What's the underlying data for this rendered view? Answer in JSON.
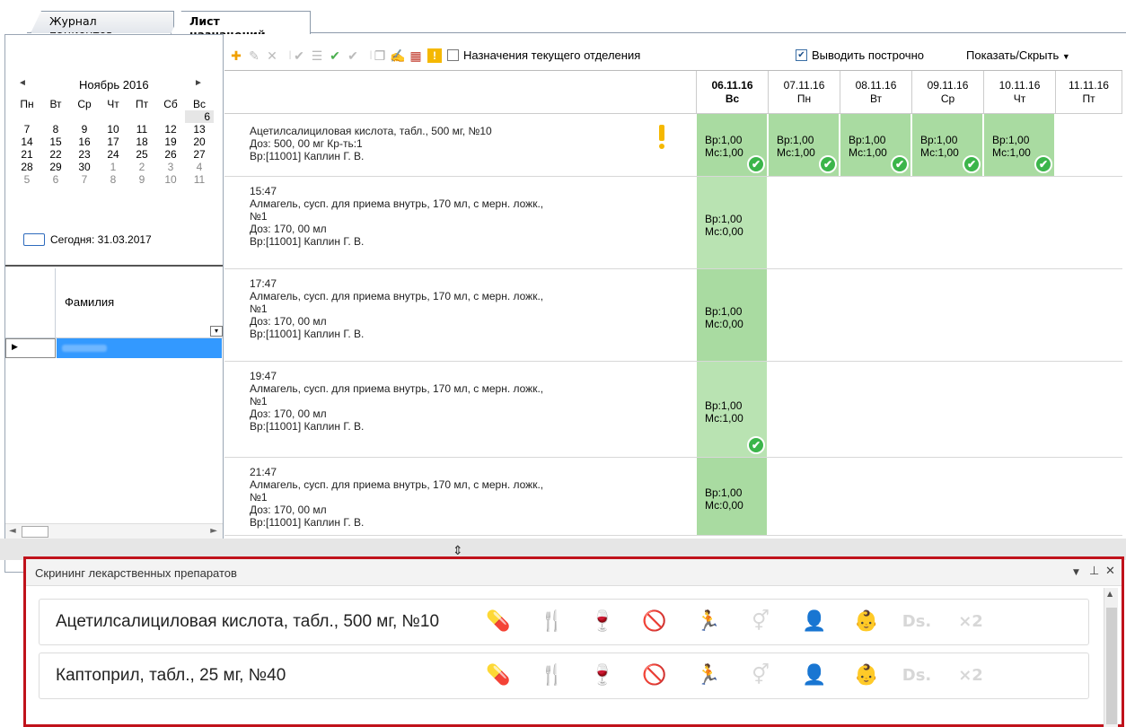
{
  "tabs": [
    {
      "label": "Журнал пациентов"
    },
    {
      "label": "Лист назначений"
    }
  ],
  "calendar": {
    "month": "Ноябрь 2016",
    "weekdays": [
      "Пн",
      "Вт",
      "Ср",
      "Чт",
      "Пт",
      "Сб",
      "Вс"
    ],
    "weeks": [
      [
        "",
        "",
        "",
        "",
        "",
        "",
        "6"
      ],
      [
        "7",
        "8",
        "9",
        "10",
        "11",
        "12",
        "13"
      ],
      [
        "14",
        "15",
        "16",
        "17",
        "18",
        "19",
        "20"
      ],
      [
        "21",
        "22",
        "23",
        "24",
        "25",
        "26",
        "27"
      ],
      [
        "28",
        "29",
        "30",
        "1",
        "2",
        "3",
        "4"
      ],
      [
        "5",
        "6",
        "7",
        "8",
        "9",
        "10",
        "11"
      ]
    ],
    "today": "Сегодня: 31.03.2017"
  },
  "patient_grid": {
    "column": "Фамилия",
    "pager_value": "1"
  },
  "toolbar": {
    "icons": [
      "add-icon",
      "edit-icon",
      "delete-icon",
      "check-icon",
      "list-icon",
      "all-check-icon",
      "double-check-icon",
      "copy-icon",
      "pen-icon",
      "calendar-icon",
      "warning-icon"
    ],
    "current_dept_label": "Назначения текущего отделения",
    "current_dept_checked": false,
    "row_output_label": "Выводить построчно",
    "row_output_checked": true,
    "show_hide_label": "Показать/Скрыть"
  },
  "dates": [
    {
      "date": "06.11.16",
      "day": "Вс"
    },
    {
      "date": "07.11.16",
      "day": "Пн"
    },
    {
      "date": "08.11.16",
      "day": "Вт"
    },
    {
      "date": "09.11.16",
      "day": "Ср"
    },
    {
      "date": "10.11.16",
      "day": "Чт"
    },
    {
      "date": "11.11.16",
      "day": "Пт"
    }
  ],
  "prescriptions": [
    {
      "lines": [
        "Ацетилсалициловая кислота, табл., 500 мг, №10",
        "Доз: 500, 00 мг Кр-ть:1",
        "Вр:[11001] Каплин Г. В."
      ],
      "warning": true,
      "cells": [
        {
          "vr": "Вр:1,00",
          "ms": "Мс:1,00",
          "done": true
        },
        {
          "vr": "Вр:1,00",
          "ms": "Мс:1,00",
          "done": true
        },
        {
          "vr": "Вр:1,00",
          "ms": "Мс:1,00",
          "done": true
        },
        {
          "vr": "Вр:1,00",
          "ms": "Мс:1,00",
          "done": true
        },
        {
          "vr": "Вр:1,00",
          "ms": "Мс:1,00",
          "done": true
        }
      ]
    },
    {
      "lines": [
        "15:47",
        "Алмагель, сусп. для приема внутрь, 170 мл, с мерн. ложк.,",
        "№1",
        "Доз: 170, 00 мл",
        "Вр:[11001] Каплин Г. В."
      ],
      "cells": [
        {
          "vr": "Вр:1,00",
          "ms": "Мс:0,00",
          "done": false
        }
      ]
    },
    {
      "lines": [
        "17:47",
        "Алмагель, сусп. для приема внутрь, 170 мл, с мерн. ложк.,",
        "№1",
        "Доз: 170, 00 мл",
        "Вр:[11001] Каплин Г. В."
      ],
      "cells": [
        {
          "vr": "Вр:1,00",
          "ms": "Мс:0,00",
          "done": false
        }
      ]
    },
    {
      "lines": [
        "19:47",
        "Алмагель, сусп. для приема внутрь, 170 мл, с мерн. ложк.,",
        "№1",
        "Доз: 170, 00 мл",
        "Вр:[11001] Каплин Г. В."
      ],
      "cells": [
        {
          "vr": "Вр:1,00",
          "ms": "Мс:1,00",
          "done": true
        }
      ]
    },
    {
      "lines": [
        "21:47",
        "Алмагель, сусп. для приема внутрь, 170 мл, с мерн. ложк.,",
        "№1",
        "Доз: 170, 00 мл",
        "Вр:[11001] Каплин Г. В."
      ],
      "cells": [
        {
          "vr": "Вр:1,00",
          "ms": "Мс:0,00",
          "done": false
        }
      ]
    }
  ],
  "screening": {
    "title": "Скрининг лекарственных препаратов",
    "drugs": [
      {
        "name": "Ацетилсалициловая кислота, табл., 500 мг, №10",
        "icons": [
          "on",
          "on",
          "blue",
          "off",
          "off",
          "off",
          "off",
          "off",
          "off",
          "off"
        ]
      },
      {
        "name": "Каптоприл, табл., 25 мг, №40",
        "icons": [
          "on",
          "on",
          "off",
          "off",
          "off",
          "off",
          "off",
          "off",
          "off",
          "off"
        ]
      }
    ],
    "icon_glyphs": [
      "💊",
      "🍴",
      "🍷",
      "🚫",
      "🏃",
      "⚥",
      "👤",
      "👶",
      "Ds.",
      "×2"
    ],
    "icon_names": [
      "pills-icon",
      "food-icon",
      "alcohol-icon",
      "driving-icon",
      "children-icon",
      "gender-icon",
      "pregnancy-icon",
      "lactation-icon",
      "dosage-icon",
      "duplicate-icon"
    ]
  },
  "colors": {
    "green_dark": "#a9dba1",
    "green_light": "#b9e3b2",
    "selection": "#3399ff",
    "highlight_border": "#c0121b",
    "warning": "#f5b800"
  }
}
